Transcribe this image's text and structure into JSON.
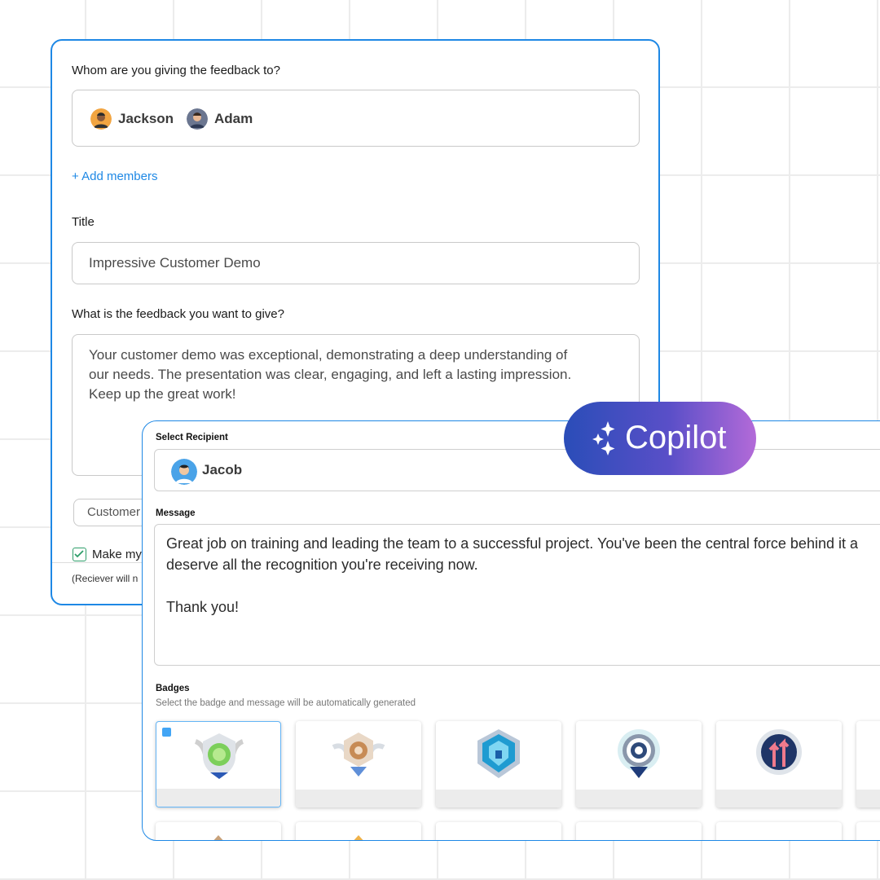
{
  "feedback_form": {
    "recipients_label": "Whom are you giving the feedback to?",
    "recipients": [
      {
        "name": "Jackson",
        "avatar_icon": "person-avatar-icon"
      },
      {
        "name": "Adam",
        "avatar_icon": "person-avatar-icon"
      }
    ],
    "add_members_label": "+ Add members",
    "title_label": "Title",
    "title_value": "Impressive Customer Demo",
    "feedback_label": "What is the feedback you want to give?",
    "feedback_value": "Your customer demo was exceptional, demonstrating a deep understanding of our needs. The presentation was clear, engaging, and left a lasting impression. Keep up the great work!",
    "feedback_lines": [
      "Your customer demo was exceptional, demonstrating a deep understanding of",
      "our needs. The presentation was clear, engaging, and left a lasting impression.",
      "Keep up the great work!"
    ],
    "category_value": "Customer",
    "checkbox_label": "Make my",
    "note": "(Reciever will n"
  },
  "copilot": {
    "label": "Copilot",
    "gradient": [
      "#2a4db8",
      "#b36ad8"
    ]
  },
  "recognition_form": {
    "recipient_label": "Select Recipient",
    "recipient": "Jacob",
    "message_label": "Message",
    "message_lines": [
      "Great job on training and leading the team to a successful project. You've been the central force behind it a",
      "deserve all the recognition you're receiving now.",
      "",
      "Thank you!"
    ],
    "badges_label": "Badges",
    "badges_hint": "Select the badge and message will be automatically generated",
    "badges": [
      {
        "icon": "winged-green-shield-badge-icon",
        "selected": true
      },
      {
        "icon": "winged-bronze-hexagon-badge-icon",
        "selected": false
      },
      {
        "icon": "blue-shield-badge-icon",
        "selected": false
      },
      {
        "icon": "target-medal-badge-icon",
        "selected": false
      },
      {
        "icon": "arrows-up-medal-badge-icon",
        "selected": false
      },
      {
        "icon": "badge-icon",
        "selected": false
      }
    ]
  },
  "colors": {
    "accent": "#1e88e5",
    "check_green": "#2e9e6a",
    "grid": "#ececec"
  }
}
